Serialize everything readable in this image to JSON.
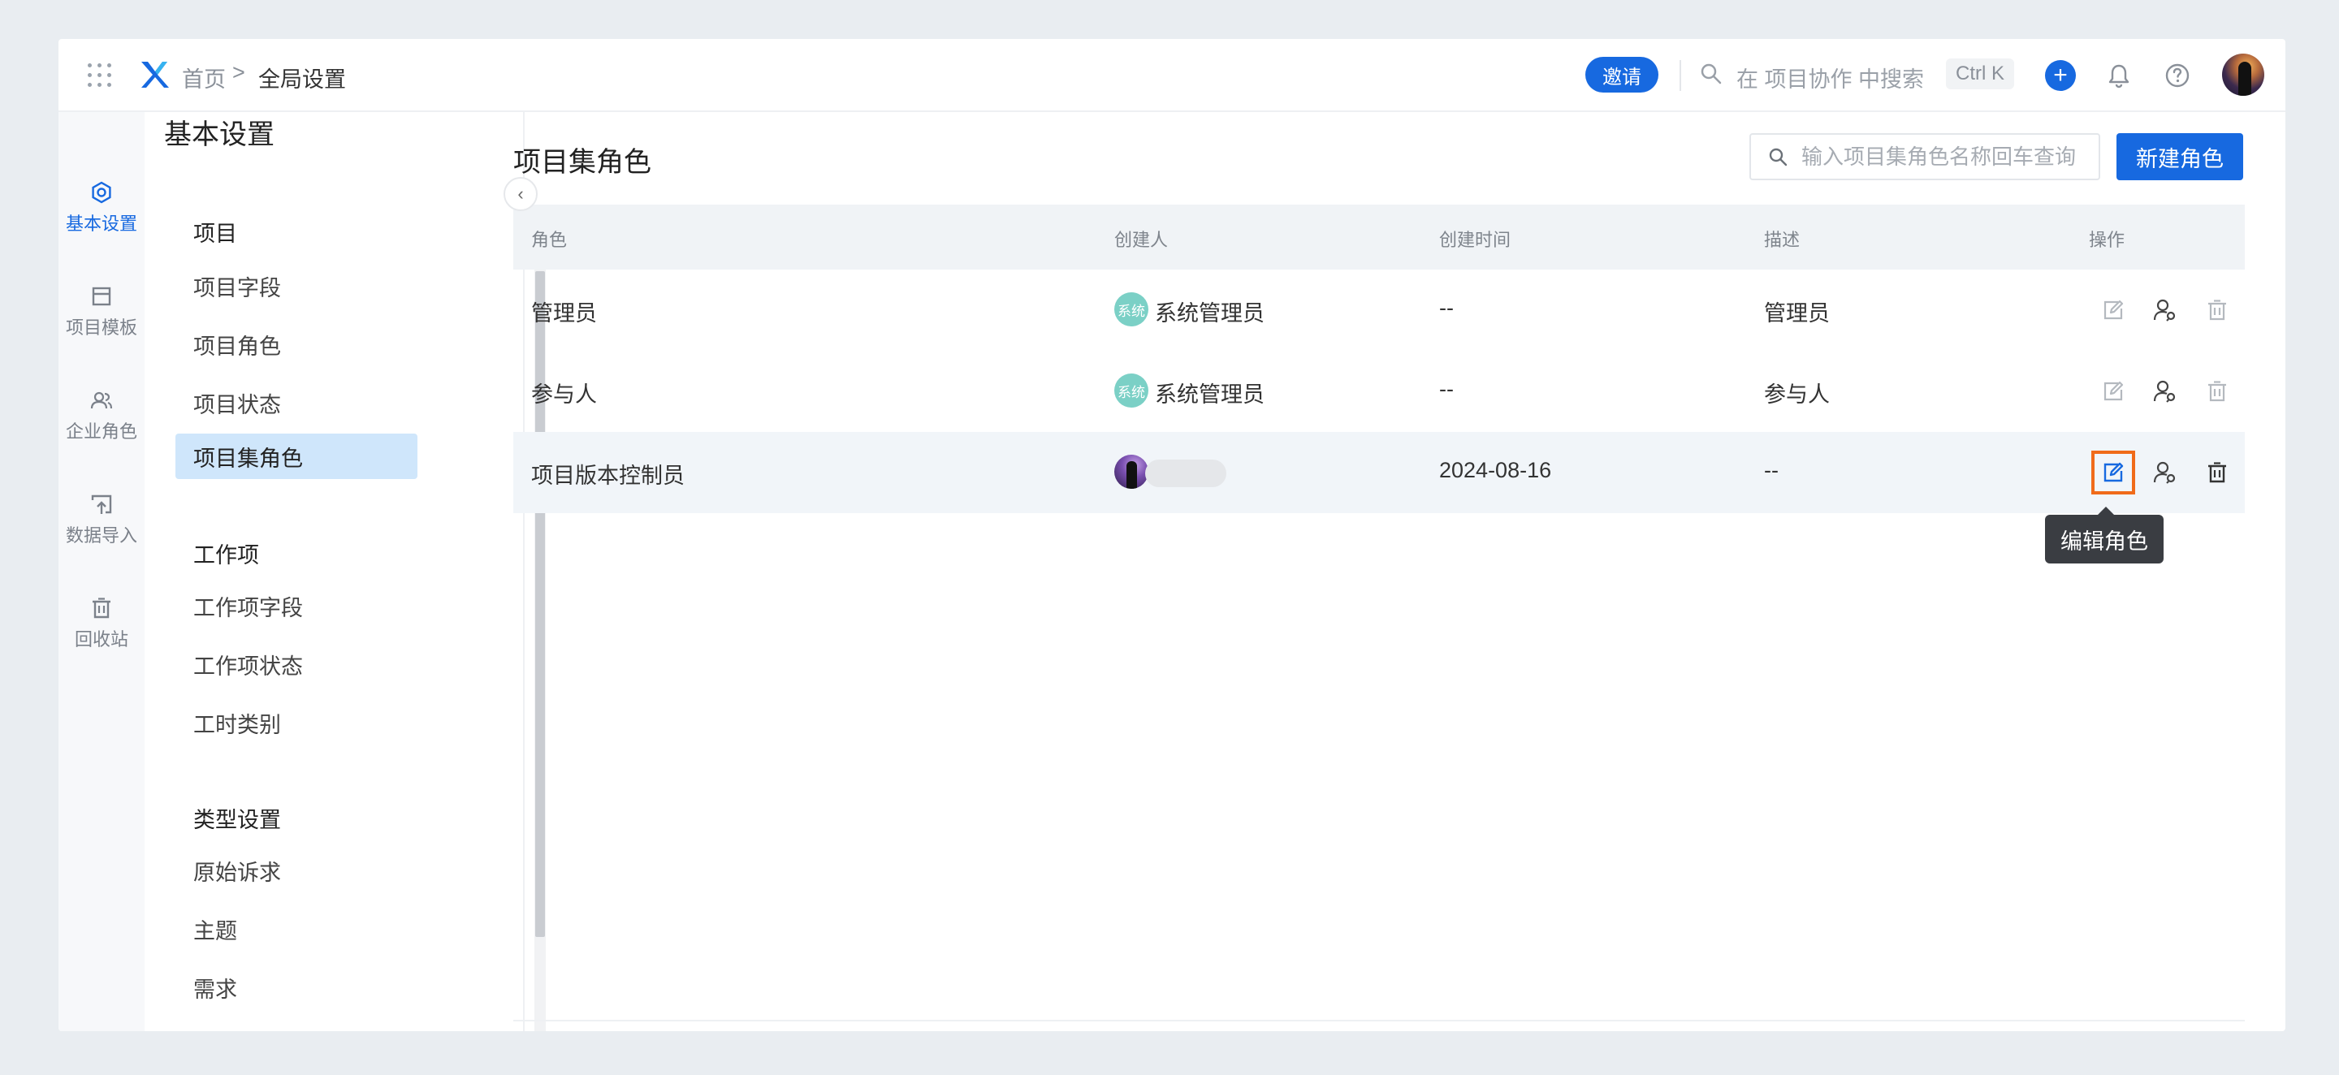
{
  "header": {
    "breadcrumb_home": "首页",
    "breadcrumb_sep": ">",
    "breadcrumb_current": "全局设置",
    "invite_label": "邀请",
    "search_placeholder": "在 项目协作 中搜索",
    "shortcut": "Ctrl K",
    "plus": "+"
  },
  "rail": {
    "items": [
      {
        "label": "基本设置",
        "icon": "settings-icon",
        "active": true
      },
      {
        "label": "项目模板",
        "icon": "template-icon"
      },
      {
        "label": "企业角色",
        "icon": "users-icon"
      },
      {
        "label": "数据导入",
        "icon": "import-icon"
      },
      {
        "label": "回收站",
        "icon": "trash-icon"
      }
    ]
  },
  "sidebar": {
    "title": "基本设置",
    "collapse": "‹",
    "groups": [
      {
        "label": "项目",
        "items": [
          "项目字段",
          "项目角色",
          "项目状态",
          "项目集角色"
        ]
      },
      {
        "label": "工作项",
        "items": [
          "工作项字段",
          "工作项状态",
          "工时类别"
        ]
      },
      {
        "label": "类型设置",
        "items": [
          "原始诉求",
          "主题",
          "需求"
        ]
      }
    ],
    "active_item": "项目集角色"
  },
  "main": {
    "title": "项目集角色",
    "search_placeholder": "输入项目集角色名称回车查询",
    "new_button": "新建角色",
    "columns": [
      "角色",
      "创建人",
      "创建时间",
      "描述",
      "操作"
    ],
    "rows": [
      {
        "role": "管理员",
        "creator_avatar": "系统",
        "creator": "系统管理员",
        "created": "--",
        "desc": "管理员"
      },
      {
        "role": "参与人",
        "creator_avatar": "系统",
        "creator": "系统管理员",
        "created": "--",
        "desc": "参与人"
      },
      {
        "role": "项目版本控制员",
        "creator_avatar": "",
        "creator": "",
        "created": "2024-08-16",
        "desc": "--"
      }
    ],
    "tooltip": "编辑角色"
  },
  "colors": {
    "primary": "#1769e0",
    "focus_outline": "#f06b1a",
    "active_nav_bg": "#cfe6fb"
  }
}
